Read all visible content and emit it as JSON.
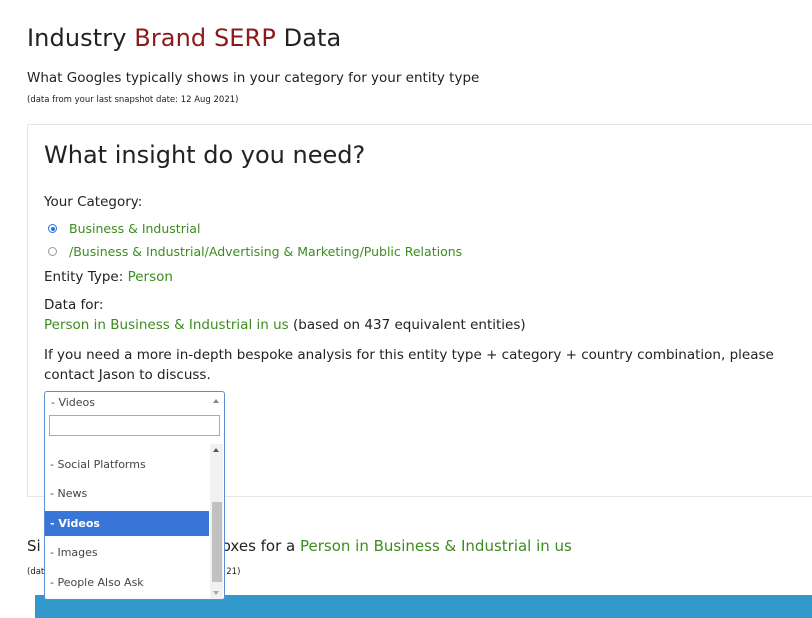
{
  "header": {
    "title_pre": "Industry ",
    "title_brand": "Brand SERP",
    "title_post": " Data",
    "subtitle": "What Googles typically shows in your category for your entity type",
    "snapshot_note": "(data from your last snapshot date: 12 Aug 2021)"
  },
  "panel": {
    "heading": "What insight do you need?",
    "category_label": "Your Category:",
    "categories": [
      {
        "label": "Business & Industrial",
        "checked": true
      },
      {
        "label": "/Business & Industrial/Advertising & Marketing/Public Relations",
        "checked": false
      }
    ],
    "entity_label": "Entity Type: ",
    "entity_value": "Person",
    "data_for_label": "Data for:",
    "data_for_value": "Person in Business & Industrial in us",
    "data_for_suffix": " (based on 437 equivalent entities)",
    "contact_text": "If you need a more in-depth bespoke analysis for this entity type + category + country combination, please contact Jason to discuss."
  },
  "select": {
    "current_value": "- Videos",
    "search_value": "",
    "options": [
      {
        "label": "- Social Platforms",
        "selected": false
      },
      {
        "label": "- News",
        "selected": false
      },
      {
        "label": "- Videos",
        "selected": true
      },
      {
        "label": "- Images",
        "selected": false
      },
      {
        "label": "- People Also Ask",
        "selected": false
      }
    ]
  },
  "lower": {
    "title_visible_pre": "Si",
    "title_visible_mid": "oxes for a ",
    "title_green": "Person in Business & Industrial in us",
    "note_visible_pre": "(dat",
    "note_visible_post": "21)"
  },
  "colors": {
    "brand": "#8b1a1a",
    "green": "#3c8c1e",
    "selected_option": "#3875d7",
    "bar": "#3399cc"
  }
}
